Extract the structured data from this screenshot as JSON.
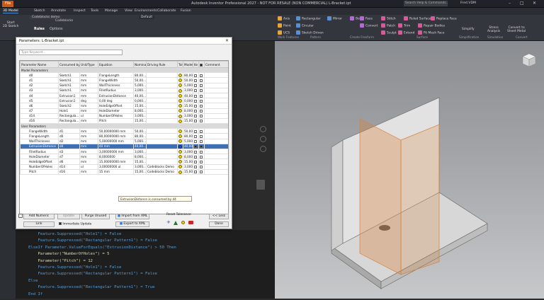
{
  "app": {
    "title": "Autodesk Inventor Professional 2027 - NOT FOR RESALE (NON COMMERCIAL)   L-Bracket.ipt",
    "search_placeholder": "Search Help & Commands...",
    "user": "Fred.VDM",
    "file_btn": "File"
  },
  "ribbon_tabs": [
    "3D Model",
    "Sketch",
    "Annotate",
    "Inspect",
    "Tools",
    "Manage",
    "View",
    "Environments",
    "Collaborate",
    "Fusion"
  ],
  "ribbon": {
    "start_sketch": "Start\n2D Sketch",
    "default_label": "Default",
    "work_features": [
      "Axis",
      "Point",
      "UCS"
    ],
    "pattern": [
      "Rectangular",
      "Circular",
      "Sketch Driven"
    ],
    "mirror": "Mirror",
    "freeform": [
      "Box",
      "Face",
      "Convert"
    ],
    "surface1": [
      "Stitch",
      "Patch",
      "Sculpt"
    ],
    "surface2": [
      "Trim",
      "Extend"
    ],
    "surface3": [
      "Ruled Surface",
      "Repair Bodies",
      "Fit Mesh Face"
    ],
    "surface4": [
      "Replace Face"
    ],
    "simplify": "Simplify",
    "stress": "Stress\nAnalysis",
    "convert": "Convert to\nSheet Metal",
    "groups": [
      "Work Features",
      "Pattern",
      "Create Freeform",
      "Surface",
      "Simplification",
      "Simulation",
      "Convert"
    ]
  },
  "doc_tabs": [
    "Codeblocks demo",
    "Codeblocks"
  ],
  "ilogic_tabs": [
    "Rules",
    "Options"
  ],
  "dialog": {
    "title": "Parameters: L-Bracket.ipt",
    "search_placeholder": "Type Keyword...",
    "columns": [
      "Parameter Name",
      "Consumed by",
      "Unit/Type",
      "Equation",
      "Nominal",
      "Driving Rule",
      "Tol.",
      "Model V..",
      "Ke",
      "Comment"
    ],
    "model_section": "Model Parameters",
    "user_section": "User Parameters",
    "model_rows": [
      {
        "name": "d0",
        "consumed": "Sketch1",
        "unit": "mm",
        "eq": "FlangeLength",
        "nom": "80,00...",
        "rule": "",
        "mv": "80,00..."
      },
      {
        "name": "d1",
        "consumed": "Sketch1",
        "unit": "mm",
        "eq": "FlangeWidth",
        "nom": "50,00...",
        "rule": "",
        "mv": "50,00..."
      },
      {
        "name": "d2",
        "consumed": "Sketch1",
        "unit": "mm",
        "eq": "WallThickness",
        "nom": "5,000...",
        "rule": "",
        "mv": "5,000..."
      },
      {
        "name": "d3",
        "consumed": "Sketch1",
        "unit": "mm",
        "eq": "FilletRadius",
        "nom": "3,000...",
        "rule": "",
        "mv": "3,000..."
      },
      {
        "name": "d4",
        "consumed": "Extrusion1",
        "unit": "mm",
        "eq": "ExtrusionDistance",
        "nom": "40,00...",
        "rule": "",
        "mv": "40,00..."
      },
      {
        "name": "d5",
        "consumed": "Extrusion1",
        "unit": "deg",
        "eq": "0,00 deg",
        "nom": "0,000...",
        "rule": "",
        "mv": "0,000..."
      },
      {
        "name": "d6",
        "consumed": "Sketch2",
        "unit": "mm",
        "eq": "HoleEdgeOffset",
        "nom": "15,00...",
        "rule": "",
        "mv": "15,00..."
      },
      {
        "name": "d7",
        "consumed": "Hole1",
        "unit": "mm",
        "eq": "HoleDiameter",
        "nom": "8,000...",
        "rule": "",
        "mv": "8,000..."
      },
      {
        "name": "d14",
        "consumed": "Rectangula...",
        "unit": "ul",
        "eq": "NumberOfHoles",
        "nom": "3,000...",
        "rule": "",
        "mv": "3,000..."
      },
      {
        "name": "d16",
        "consumed": "Rectangula...",
        "unit": "mm",
        "eq": "Pitch",
        "nom": "15,00...",
        "rule": "",
        "mv": "15,00..."
      }
    ],
    "user_rows": [
      {
        "name": "FlangeWidth",
        "consumed": "d1",
        "unit": "mm",
        "eq": "50,00000000 mm",
        "nom": "50,00...",
        "rule": "",
        "mv": "50,00..."
      },
      {
        "name": "FlangeLength",
        "consumed": "d0",
        "unit": "mm",
        "eq": "80,00000000 mm",
        "nom": "80,00...",
        "rule": "",
        "mv": "80,00..."
      },
      {
        "name": "WallThickness",
        "consumed": "d2",
        "unit": "mm",
        "eq": "5,00000000 mm",
        "nom": "5,000...",
        "rule": "",
        "mv": "5,000..."
      },
      {
        "name": "ExtrusionDistance",
        "consumed": "d4",
        "unit": "mm",
        "eq": "40 mm",
        "nom": "40,00...",
        "rule": "",
        "mv": "40,00..."
      },
      {
        "name": "FilletRadius",
        "consumed": "d3",
        "unit": "mm",
        "eq": "3,00000000 mm",
        "nom": "3,000...",
        "rule": "",
        "mv": "3,000..."
      },
      {
        "name": "HoleDiameter",
        "consumed": "d7",
        "unit": "mm",
        "eq": "8,0000000",
        "nom": "8,000...",
        "rule": "",
        "mv": "8,000..."
      },
      {
        "name": "HoleEdgeOffset",
        "consumed": "d6",
        "unit": "mm",
        "eq": "15,00000000 mm",
        "nom": "15,00...",
        "rule": "",
        "mv": "15,00..."
      },
      {
        "name": "NumberOfHoles",
        "consumed": "d14",
        "unit": "ul",
        "eq": "3,00000000 ul",
        "nom": "3,000...",
        "rule": "Codeblocks Demo",
        "mv": "3,000..."
      },
      {
        "name": "Pitch",
        "consumed": "d16",
        "unit": "mm",
        "eq": "15 mm",
        "nom": "15,00...",
        "rule": "Codeblocks Demo",
        "mv": "15,00..."
      }
    ],
    "tooltip": "ExtrusionDistance is consumed by d4",
    "add_numeric": "Add Numeric",
    "update": "Update",
    "purge": "Purge Unused",
    "import_xml": "Import from XML",
    "export_xml": "Export to XML",
    "link": "Link",
    "immediate_update": "Immediate Update",
    "reset_tolerance": "Reset Tolerance",
    "less": "<< Less",
    "done": "Done"
  },
  "code_lines": [
    "    Feature.Suppressed(\"Hole1\") = False",
    "    Feature.Suppressed(\"Rectangular Pattern1\") = False",
    "ElseIf Parameter.ValueForEquals(\"ExtrusionDistance\") > 50 Then",
    "    Parameter(\"NumberOfHoles\") = 5",
    "    Parameter(\"Pitch\") = 12",
    "    Feature.Suppressed(\"Hole1\") = False",
    "    Feature.Suppressed(\"Rectangular Pattern1\") = False",
    "Else",
    "    Feature.Suppressed(\"Rectangular Pattern1\") = True",
    "End If"
  ]
}
